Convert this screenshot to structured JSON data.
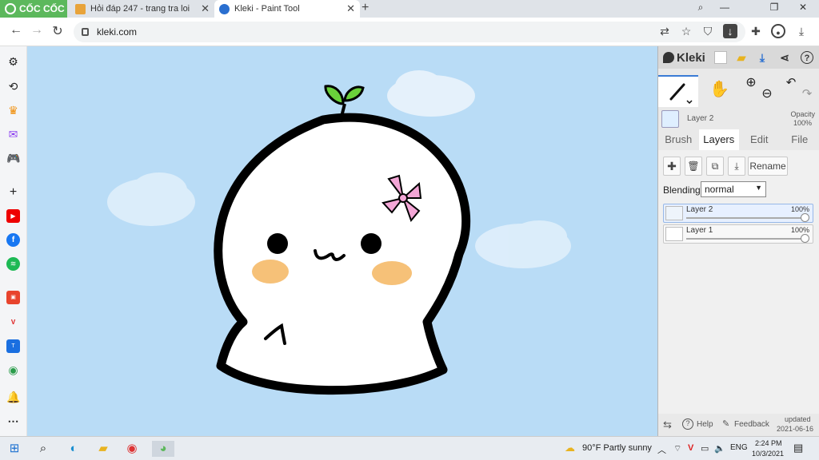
{
  "browser": {
    "brand": "CỐC CỐC",
    "tabs": [
      {
        "title": "Hỏi đáp 247 - trang tra loi",
        "close": "✕"
      },
      {
        "title": "Kleki - Paint Tool",
        "close": "✕"
      }
    ],
    "new_tab": "+",
    "url": "kleki.com"
  },
  "kleki": {
    "app_name": "Kleki",
    "current_layer": "Layer 2",
    "opacity_label": "Opacity",
    "opacity_value": "100%",
    "tabs": [
      "Brush",
      "Layers",
      "Edit",
      "File"
    ],
    "rename_label": "Rename",
    "blending_label": "Blending",
    "blending_value": "normal",
    "layers": [
      {
        "name": "Layer 2",
        "opacity": "100%"
      },
      {
        "name": "Layer 1",
        "opacity": "100%"
      }
    ],
    "help_label": "Help",
    "feedback_label": "Feedback",
    "updated_label": "updated",
    "updated_date": "2021-06-16"
  },
  "taskbar": {
    "weather": "90°F  Partly sunny",
    "language": "ENG",
    "time": "2:24 PM",
    "date": "10/3/2021"
  },
  "colors": {
    "sky": "#b9dcf6",
    "accent": "#3a7bd5",
    "coccoc_green": "#5cb85c"
  }
}
